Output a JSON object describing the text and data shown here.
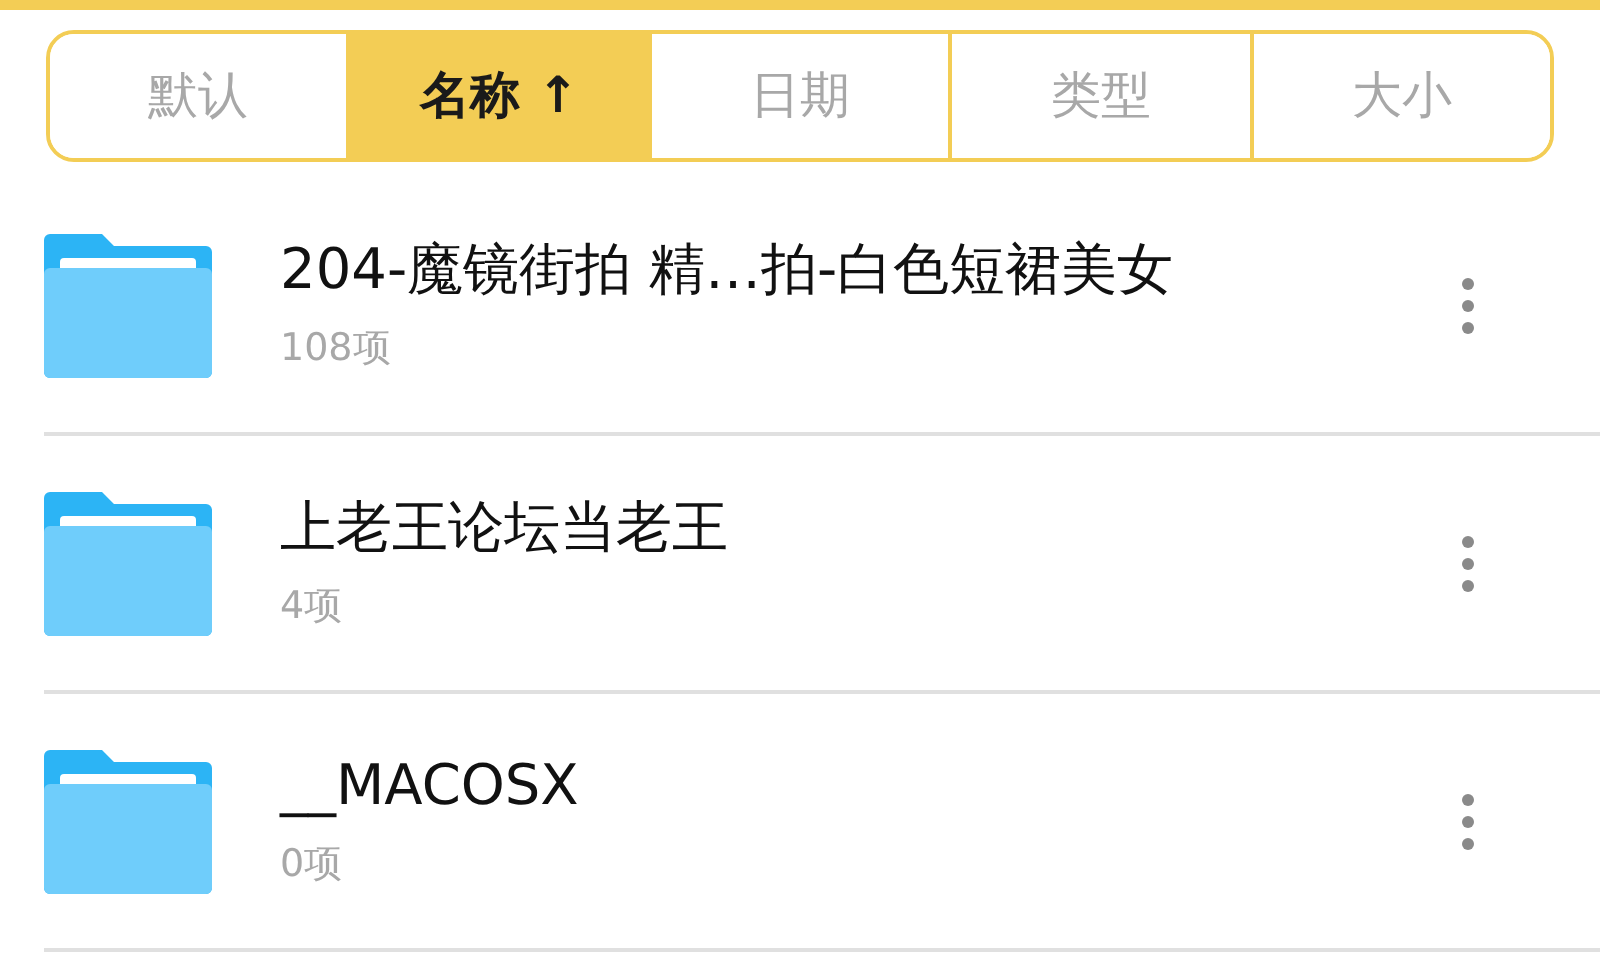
{
  "sort_tabs": [
    {
      "label": "默认",
      "selected": false
    },
    {
      "label": "名称 ↑",
      "selected": true
    },
    {
      "label": "日期",
      "selected": false
    },
    {
      "label": "类型",
      "selected": false
    },
    {
      "label": "大小",
      "selected": false
    }
  ],
  "files": [
    {
      "name": "204-魔镜街拍 精…拍-白色短裙美女",
      "count": "108项"
    },
    {
      "name": "上老王论坛当老王",
      "count": "4项"
    },
    {
      "name": "__MACOSX",
      "count": "0项"
    }
  ]
}
